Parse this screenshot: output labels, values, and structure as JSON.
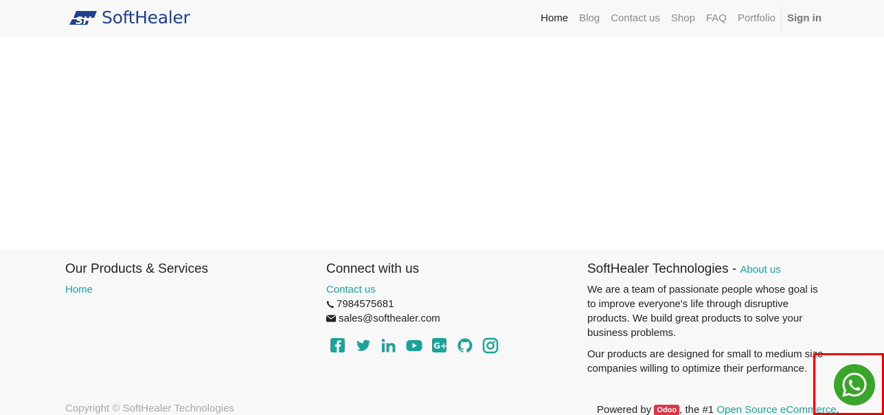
{
  "brand": {
    "name": "SoftHealer",
    "mark": "SH",
    "color": "#1f3f8f"
  },
  "nav": {
    "items": [
      "Home",
      "Blog",
      "Contact us",
      "Shop",
      "FAQ",
      "Portfolio"
    ],
    "active": "Home",
    "signin": "Sign in"
  },
  "footer": {
    "products": {
      "title": "Our Products & Services",
      "links": [
        "Home"
      ]
    },
    "connect": {
      "title": "Connect with us",
      "contact_link": "Contact us",
      "phone": "7984575681",
      "email": "sales@softhealer.com",
      "social_icons": [
        "facebook-icon",
        "twitter-icon",
        "linkedin-icon",
        "youtube-icon",
        "google-plus-icon",
        "github-icon",
        "instagram-icon"
      ]
    },
    "about": {
      "title": "SoftHealer Technologies",
      "separator": " - ",
      "about_link": "About us",
      "para1": "We are a team of passionate people whose goal is to improve everyone's life through disruptive products. We build great products to solve your business problems.",
      "para2": "Our products are designed for small to medium size companies willing to optimize their performance."
    },
    "copyright": "Copyright © SoftHealer Technologies",
    "powered": {
      "prefix": "Powered by ",
      "badge": "Odoo",
      "middle": ", the #1 ",
      "link": "Open Source eCommerce",
      "suffix": "."
    }
  },
  "colors": {
    "accent": "#1aa39a",
    "whatsapp": "#39a52a",
    "highlight": "#ee0000",
    "badge": "#dc3545"
  },
  "whatsapp": {
    "icon": "whatsapp-icon"
  }
}
